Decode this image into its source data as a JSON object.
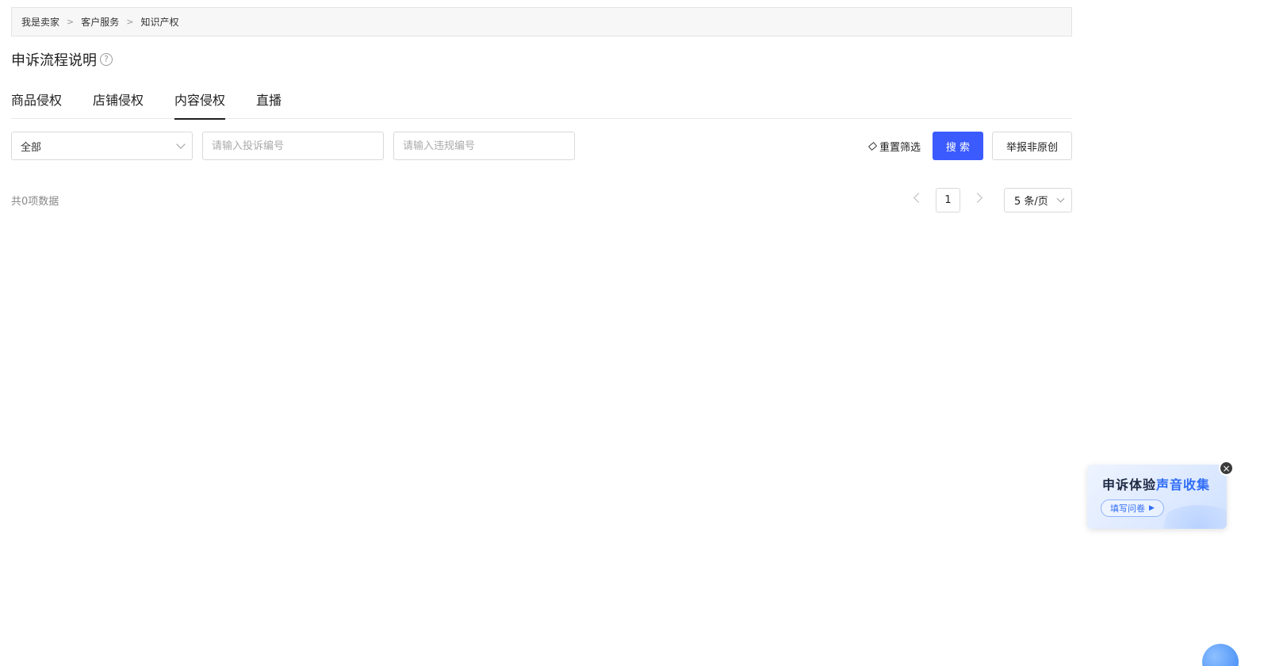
{
  "breadcrumb": {
    "items": [
      "我是卖家",
      "客户服务",
      "知识产权"
    ],
    "separator": ">"
  },
  "page": {
    "title": "申诉流程说明",
    "help_icon": "?"
  },
  "tabs": [
    {
      "label": "商品侵权",
      "active": false
    },
    {
      "label": "店铺侵权",
      "active": false
    },
    {
      "label": "内容侵权",
      "active": true
    },
    {
      "label": "直播",
      "active": false
    }
  ],
  "filters": {
    "type_select": {
      "value": "全部"
    },
    "complaint_no": {
      "placeholder": "请输入投诉编号"
    },
    "violation_no": {
      "placeholder": "请输入违规编号"
    },
    "reset_label": "重置筛选",
    "search_label": "搜 索",
    "report_label": "举报非原创"
  },
  "pagination": {
    "total_text": "共0项数据",
    "current_page": "1",
    "page_size_label": "5 条/页"
  },
  "survey": {
    "title_dark": "申诉体验",
    "title_blue": "声音收集",
    "button_label": "填写问卷",
    "button_icon": "▶",
    "close_icon": "×"
  },
  "colors": {
    "primary": "#3b5bff",
    "survey_blue": "#2f6cf5"
  }
}
